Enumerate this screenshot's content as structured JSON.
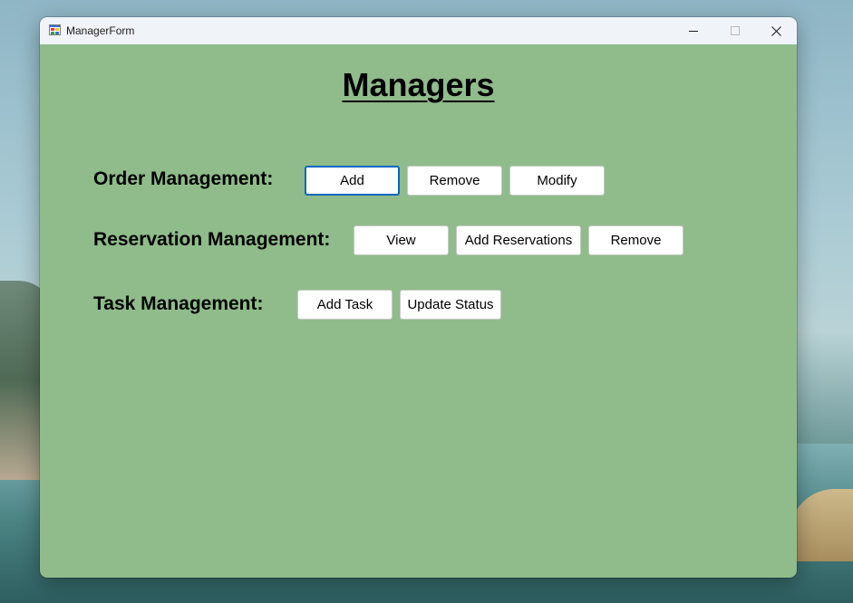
{
  "window": {
    "title": "ManagerForm",
    "background_color": "#8fbc8a",
    "controls": {
      "minimize_icon": "minimize-icon",
      "maximize_icon": "maximize-icon",
      "close_icon": "close-icon"
    }
  },
  "form": {
    "title": "Managers",
    "sections": {
      "order": {
        "label": "Order Management:",
        "buttons": {
          "add": "Add",
          "remove": "Remove",
          "modify": "Modify"
        }
      },
      "reservation": {
        "label": "Reservation Management:",
        "buttons": {
          "view": "View",
          "add_reservations": "Add Reservations",
          "remove": "Remove"
        }
      },
      "task": {
        "label": "Task Management:",
        "buttons": {
          "add_task": "Add Task",
          "update_status": "Update Status"
        }
      }
    }
  },
  "colors": {
    "focus_border": "#0067c0",
    "button_background": "#ffffff"
  }
}
